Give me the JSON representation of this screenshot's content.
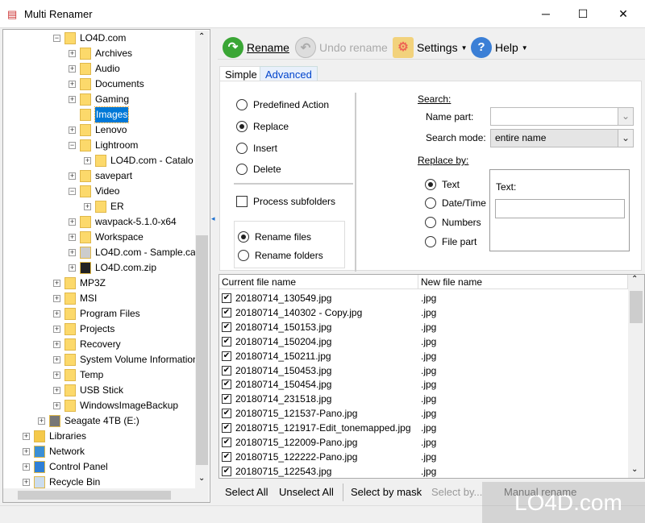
{
  "window": {
    "title": "Multi Renamer",
    "minimize": "─",
    "maximize": "☐",
    "close": "✕"
  },
  "tree": {
    "items": [
      {
        "label": "LO4D.com",
        "level": 2,
        "exp": "-",
        "icon": "folder"
      },
      {
        "label": "Archives",
        "level": 3,
        "exp": "+",
        "icon": "folder"
      },
      {
        "label": "Audio",
        "level": 3,
        "exp": "+",
        "icon": "folder"
      },
      {
        "label": "Documents",
        "level": 3,
        "exp": "+",
        "icon": "folder"
      },
      {
        "label": "Gaming",
        "level": 3,
        "exp": "+",
        "icon": "folder"
      },
      {
        "label": "Images",
        "level": 3,
        "exp": "",
        "icon": "folder",
        "selected": true
      },
      {
        "label": "Lenovo",
        "level": 3,
        "exp": "+",
        "icon": "folder"
      },
      {
        "label": "Lightroom",
        "level": 3,
        "exp": "-",
        "icon": "folder"
      },
      {
        "label": "LO4D.com - Catalo",
        "level": 4,
        "exp": "+",
        "icon": "folder"
      },
      {
        "label": "savepart",
        "level": 3,
        "exp": "+",
        "icon": "folder"
      },
      {
        "label": "Video",
        "level": 3,
        "exp": "-",
        "icon": "folder"
      },
      {
        "label": "ER",
        "level": 4,
        "exp": "+",
        "icon": "folder"
      },
      {
        "label": "wavpack-5.1.0-x64",
        "level": 3,
        "exp": "+",
        "icon": "folder"
      },
      {
        "label": "Workspace",
        "level": 3,
        "exp": "+",
        "icon": "folder"
      },
      {
        "label": "LO4D.com - Sample.ca",
        "level": 3,
        "exp": "+",
        "icon": "cabinet"
      },
      {
        "label": "LO4D.com.zip",
        "level": 3,
        "exp": "+",
        "icon": "7z"
      },
      {
        "label": "MP3Z",
        "level": 2,
        "exp": "+",
        "icon": "folder"
      },
      {
        "label": "MSI",
        "level": 2,
        "exp": "+",
        "icon": "folder"
      },
      {
        "label": "Program Files",
        "level": 2,
        "exp": "+",
        "icon": "folder"
      },
      {
        "label": "Projects",
        "level": 2,
        "exp": "+",
        "icon": "folder"
      },
      {
        "label": "Recovery",
        "level": 2,
        "exp": "+",
        "icon": "folder"
      },
      {
        "label": "System Volume Information",
        "level": 2,
        "exp": "+",
        "icon": "folder"
      },
      {
        "label": "Temp",
        "level": 2,
        "exp": "+",
        "icon": "folder"
      },
      {
        "label": "USB Stick",
        "level": 2,
        "exp": "+",
        "icon": "folder"
      },
      {
        "label": "WindowsImageBackup",
        "level": 2,
        "exp": "+",
        "icon": "folder"
      },
      {
        "label": "Seagate 4TB (E:)",
        "level": 1,
        "exp": "+",
        "icon": "drive"
      },
      {
        "label": "Libraries",
        "level": 0,
        "exp": "+",
        "icon": "libraries"
      },
      {
        "label": "Network",
        "level": 0,
        "exp": "+",
        "icon": "network"
      },
      {
        "label": "Control Panel",
        "level": 0,
        "exp": "+",
        "icon": "control-panel"
      },
      {
        "label": "Recycle Bin",
        "level": 0,
        "exp": "+",
        "icon": "recycle-bin"
      }
    ]
  },
  "toolbar": {
    "rename": "Rename",
    "undo": "Undo rename",
    "settings": "Settings",
    "help": "Help"
  },
  "tabs": {
    "simple": "Simple",
    "advanced": "Advanced"
  },
  "actions": {
    "predefined": "Predefined Action",
    "replace": "Replace",
    "insert": "Insert",
    "delete": "Delete",
    "selected": "Replace"
  },
  "process_subfolders": {
    "label": "Process subfolders",
    "checked": false
  },
  "target": {
    "files": "Rename files",
    "folders": "Rename folders",
    "selected": "Rename files"
  },
  "search": {
    "heading": "Search:",
    "name_part_label": "Name part:",
    "name_part_value": "",
    "mode_label": "Search mode:",
    "mode_value": "entire name"
  },
  "replace_by": {
    "heading": "Replace by:",
    "text": "Text",
    "datetime": "Date/Time",
    "numbers": "Numbers",
    "filepart": "File part",
    "selected": "Text",
    "text_label": "Text:",
    "text_value": ""
  },
  "list": {
    "col_current": "Current file name",
    "col_new": "New file name",
    "rows": [
      {
        "cur": "20180714_130549.jpg",
        "new": ".jpg"
      },
      {
        "cur": "20180714_140302 - Copy.jpg",
        "new": ".jpg"
      },
      {
        "cur": "20180714_150153.jpg",
        "new": ".jpg"
      },
      {
        "cur": "20180714_150204.jpg",
        "new": ".jpg"
      },
      {
        "cur": "20180714_150211.jpg",
        "new": ".jpg"
      },
      {
        "cur": "20180714_150453.jpg",
        "new": ".jpg"
      },
      {
        "cur": "20180714_150454.jpg",
        "new": ".jpg"
      },
      {
        "cur": "20180714_231518.jpg",
        "new": ".jpg"
      },
      {
        "cur": "20180715_121537-Pano.jpg",
        "new": ".jpg"
      },
      {
        "cur": "20180715_121917-Edit_tonemapped.jpg",
        "new": ".jpg"
      },
      {
        "cur": "20180715_122009-Pano.jpg",
        "new": ".jpg"
      },
      {
        "cur": "20180715_122222-Pano.jpg",
        "new": ".jpg"
      },
      {
        "cur": "20180715_122543.jpg",
        "new": ".jpg"
      }
    ]
  },
  "bottom": {
    "select_all": "Select All",
    "unselect_all": "Unselect All",
    "select_by_mask": "Select by mask",
    "select_by": "Select by...",
    "manual_rename": "Manual rename"
  },
  "watermark": "LO4D.com"
}
